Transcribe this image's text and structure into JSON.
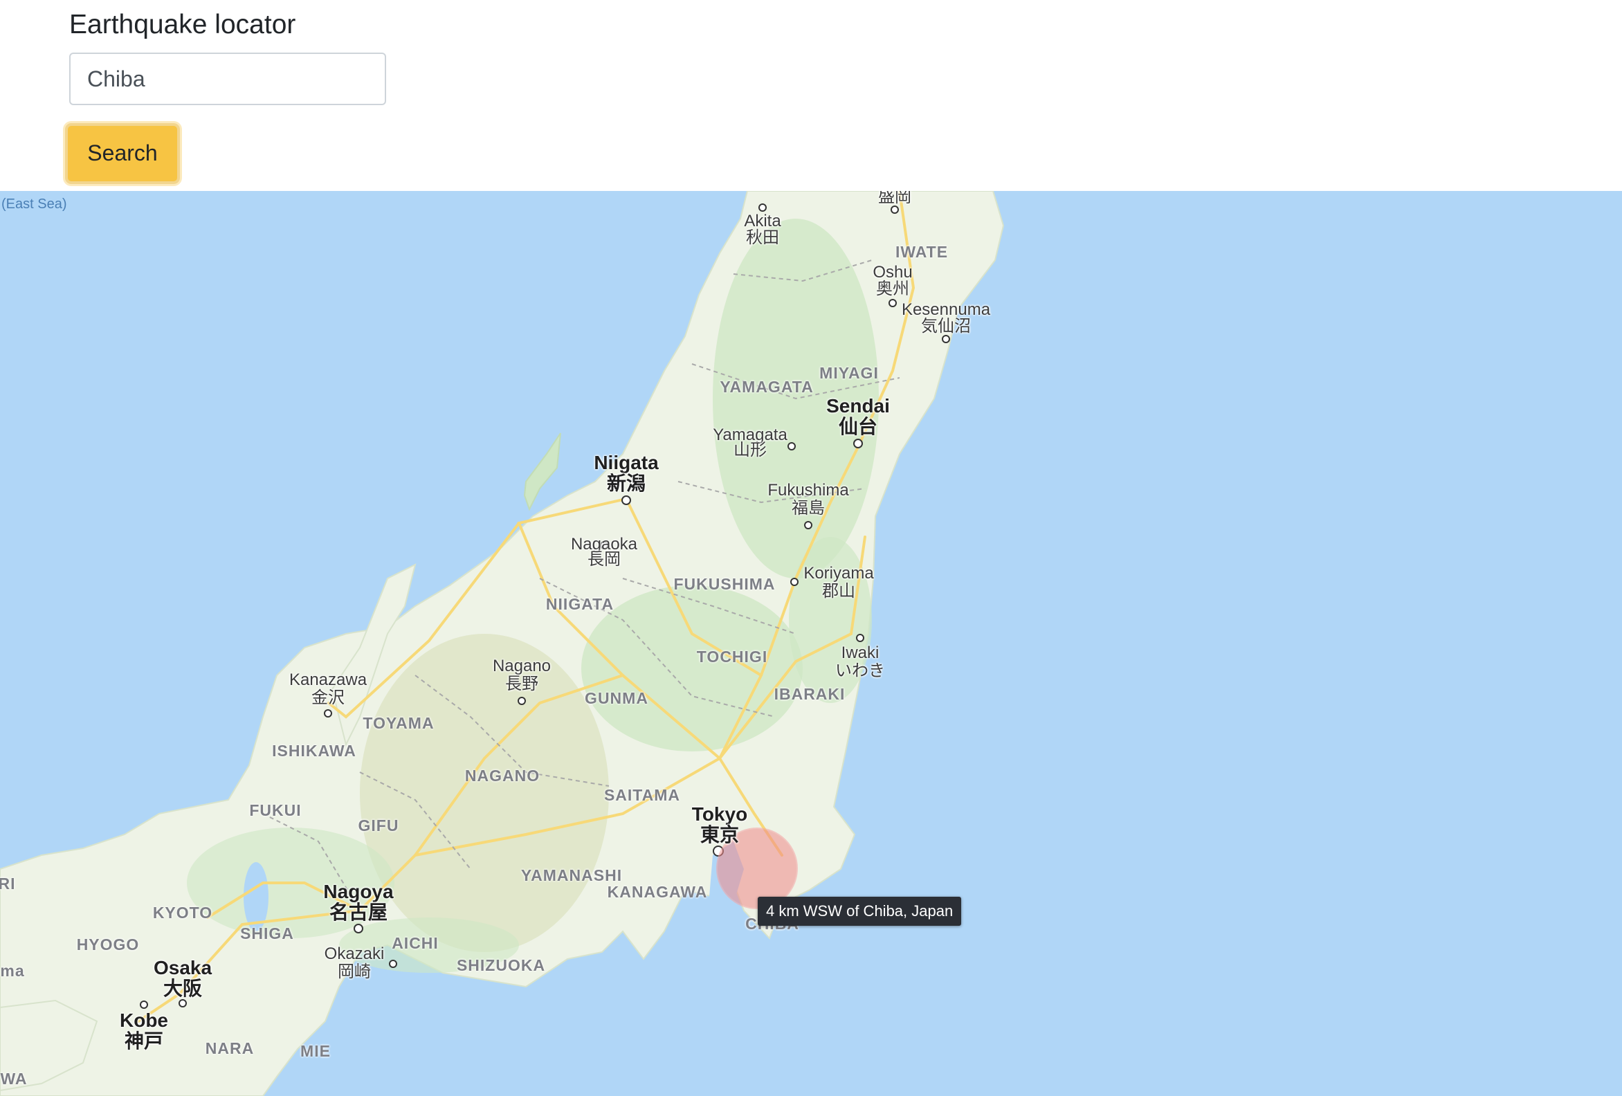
{
  "header": {
    "title": "Earthquake locator",
    "search_value": "Chiba",
    "search_button": "Search"
  },
  "map": {
    "sea_labels": [
      "(East Sea)"
    ],
    "cities": [
      {
        "id": "morioka",
        "label": "盛岡"
      },
      {
        "id": "akita",
        "label": "Akita",
        "label2": "秋田"
      },
      {
        "id": "oshu",
        "label": "Oshu",
        "label2": "奥州"
      },
      {
        "id": "kesennuma",
        "label": "Kesennuma",
        "label2": "気仙沼"
      },
      {
        "id": "sendai",
        "label": "Sendai",
        "label2": "仙台"
      },
      {
        "id": "yamagata",
        "label": "Yamagata",
        "label2": "山形"
      },
      {
        "id": "niigata",
        "label": "Niigata",
        "label2": "新潟"
      },
      {
        "id": "fukushima",
        "label": "Fukushima",
        "label2": "福島"
      },
      {
        "id": "nagaoka",
        "label": "Nagaoka",
        "label2": "長岡"
      },
      {
        "id": "koriyama",
        "label": "Koriyama",
        "label2": "郡山"
      },
      {
        "id": "iwaki",
        "label": "Iwaki",
        "label2": "いわき"
      },
      {
        "id": "nagano",
        "label": "Nagano",
        "label2": "長野"
      },
      {
        "id": "kanazawa",
        "label": "Kanazawa",
        "label2": "金沢"
      },
      {
        "id": "tokyo",
        "label": "Tokyo",
        "label2": "東京"
      },
      {
        "id": "nagoya",
        "label": "Nagoya",
        "label2": "名古屋"
      },
      {
        "id": "okazaki",
        "label": "Okazaki",
        "label2": "岡崎"
      },
      {
        "id": "osaka",
        "label": "Osaka",
        "label2": "大阪"
      },
      {
        "id": "kobe",
        "label": "Kobe",
        "label2": "神戸"
      }
    ],
    "prefectures": [
      "IWATE",
      "MIYAGI",
      "YAMAGATA",
      "FUKUSHIMA",
      "NIIGATA",
      "TOCHIGI",
      "IBARAKI",
      "GUNMA",
      "TOYAMA",
      "ISHIKAWA",
      "NAGANO",
      "SAITAMA",
      "FUKUI",
      "GIFU",
      "YAMANASHI",
      "KANAGAWA",
      "KYOTO",
      "SHIGA",
      "AICHI",
      "HYOGO",
      "SHIZUOKA",
      "NARA",
      "MIE",
      "CHIBA",
      "RI",
      "ma",
      "WA"
    ],
    "tooltip": "4 km WSW of Chiba, Japan",
    "colors": {
      "sea": "#b0d6f7",
      "land": "#eef3e6",
      "forest": "#cfe7c5",
      "road": "#f7d978",
      "marker": "#f08a8a"
    }
  }
}
